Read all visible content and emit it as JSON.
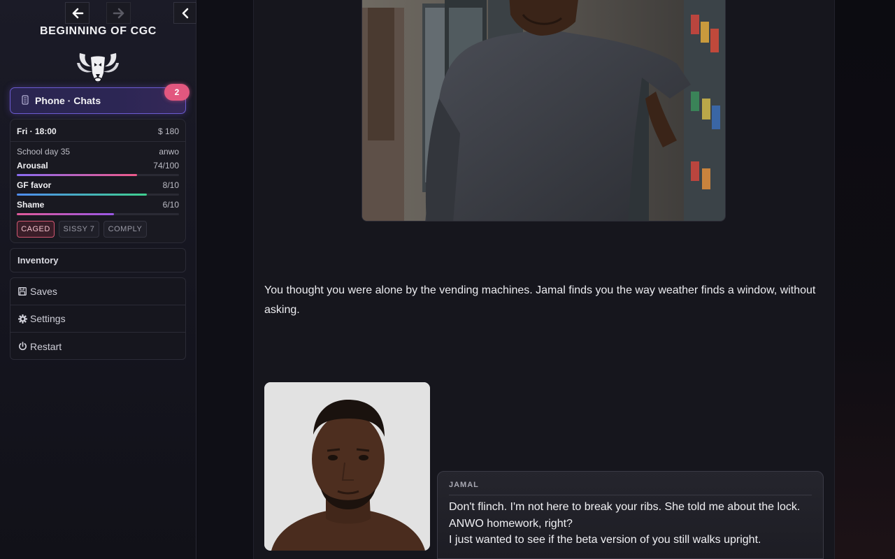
{
  "header": {
    "title": "BEGINNING OF CGC",
    "back_icon": "arrow-left-icon",
    "forward_icon": "arrow-right-icon",
    "collapse_icon": "chevron-left-icon"
  },
  "phone": {
    "label": "Phone · Chats",
    "icon": "phone-icon",
    "unread": "2"
  },
  "stats": {
    "day_time": "Fri · 18:00",
    "money": "$ 180",
    "school_day": "School day 35",
    "class_code": "anwo",
    "meters": [
      {
        "label": "Arousal",
        "value": "74/100",
        "fraction": 0.74,
        "color_from": "#8a6cf2",
        "color_to": "#ee5a8a"
      },
      {
        "label": "GF favor",
        "value": "8/10",
        "fraction": 0.8,
        "color_from": "#4f8df0",
        "color_to": "#3fd08f"
      },
      {
        "label": "Shame",
        "value": "6/10",
        "fraction": 0.6,
        "color_from": "#e05a9a",
        "color_to": "#9a58e6"
      }
    ],
    "tags": [
      "CAGED",
      "SISSY 7",
      "COMPLY"
    ]
  },
  "inventory": {
    "label": "Inventory"
  },
  "menu": {
    "saves": "Saves",
    "settings": "Settings",
    "restart": "Restart"
  },
  "story": {
    "narration": "You thought you were alone by the vending machines. Jamal finds you the way weather finds a window, without asking.",
    "speaker": "JAMAL",
    "lines": [
      "Don't flinch. I'm not here to break your ribs. She told me about the lock.",
      "ANWO homework, right?",
      "I just wanted to see if the beta version of you still walks upright."
    ]
  },
  "colors": {
    "accent": "#6b5bd0",
    "badge": "#e2577f",
    "caged": "#d05670"
  }
}
